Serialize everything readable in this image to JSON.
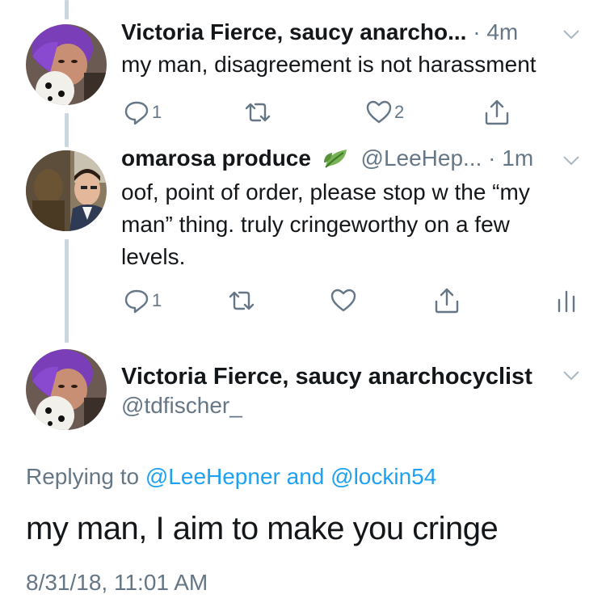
{
  "tweets": [
    {
      "display_name": "Victoria Fierce, saucy anarcho...",
      "handle": "",
      "time": "4m",
      "text": "my man, disagreement is not harassment",
      "reply_count": "1",
      "like_count": "2",
      "avatar_icon": "avatar-purple-hair-plush-toy"
    },
    {
      "display_name": "omarosa produce",
      "emoji_icon": "leaf-icon",
      "handle": "@LeeHep...",
      "time": "1m",
      "text_lines": [
        "oof, point of order, please stop w the “my",
        "man” thing. truly cringeworthy on a few",
        "levels."
      ],
      "reply_count": "1",
      "like_count": "",
      "avatar_icon": "avatar-man-with-bust"
    }
  ],
  "main_tweet": {
    "display_name": "Victoria Fierce, saucy anarchocyclist",
    "handle": "@tdfischer_",
    "replying_prefix": "Replying to",
    "replying_user1": "@LeeHepner",
    "replying_and": "and",
    "replying_user2": "@lockin54",
    "text": "my man, I aim to make you cringe",
    "timestamp": "8/31/18, 11:01 AM"
  },
  "colors": {
    "text": "#14171a",
    "muted": "#657786",
    "link": "#1da1f2",
    "thread_line": "#ccd6dd"
  }
}
